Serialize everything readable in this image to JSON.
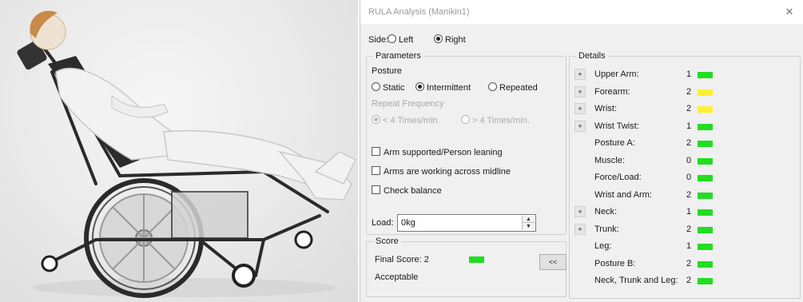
{
  "dialog": {
    "title": "RULA Analysis (Manikin1)",
    "close_glyph": "✕"
  },
  "side": {
    "label": "Side:",
    "options": [
      "Left",
      "Right"
    ],
    "selected": "Right"
  },
  "parameters": {
    "legend": "Parameters",
    "posture_label": "Posture",
    "posture_options": [
      "Static",
      "Intermittent",
      "Repeated"
    ],
    "posture_selected": "Intermittent",
    "repeat_label": "Repeat Frequency",
    "repeat_options": [
      "< 4 Times/min.",
      "> 4 Times/min."
    ],
    "checkboxes": [
      "Arm supported/Person leaning",
      "Arms are working across midline",
      "Check balance"
    ],
    "load_label": "Load:",
    "load_value": "0kg"
  },
  "score": {
    "legend": "Score",
    "final_label": "Final Score: 2",
    "verdict": "Acceptable",
    "final_color": "#22dd22",
    "collapse_label": "<<"
  },
  "details": {
    "legend": "Details",
    "rows": [
      {
        "expand": "+",
        "label": "Upper Arm:",
        "value": "1",
        "color": "#22dd22"
      },
      {
        "expand": "+",
        "label": "Forearm:",
        "value": "2",
        "color": "#ffee33"
      },
      {
        "expand": "+",
        "label": "Wrist:",
        "value": "2",
        "color": "#ffee33"
      },
      {
        "expand": "+",
        "label": "Wrist Twist:",
        "value": "1",
        "color": "#22dd22"
      },
      {
        "expand": "",
        "label": "Posture A:",
        "value": "2",
        "color": "#22dd22"
      },
      {
        "expand": "",
        "label": "Muscle:",
        "value": "0",
        "color": "#22dd22"
      },
      {
        "expand": "",
        "label": "Force/Load:",
        "value": "0",
        "color": "#22dd22"
      },
      {
        "expand": "",
        "label": "Wrist and Arm:",
        "value": "2",
        "color": "#22dd22"
      },
      {
        "expand": "+",
        "label": "Neck:",
        "value": "1",
        "color": "#22dd22"
      },
      {
        "expand": "+",
        "label": "Trunk:",
        "value": "2",
        "color": "#22dd22"
      },
      {
        "expand": "",
        "label": "Leg:",
        "value": "1",
        "color": "#22dd22"
      },
      {
        "expand": "",
        "label": "Posture B:",
        "value": "2",
        "color": "#22dd22"
      },
      {
        "expand": "",
        "label": "Neck, Trunk and Leg:",
        "value": "2",
        "color": "#22dd22"
      }
    ]
  }
}
